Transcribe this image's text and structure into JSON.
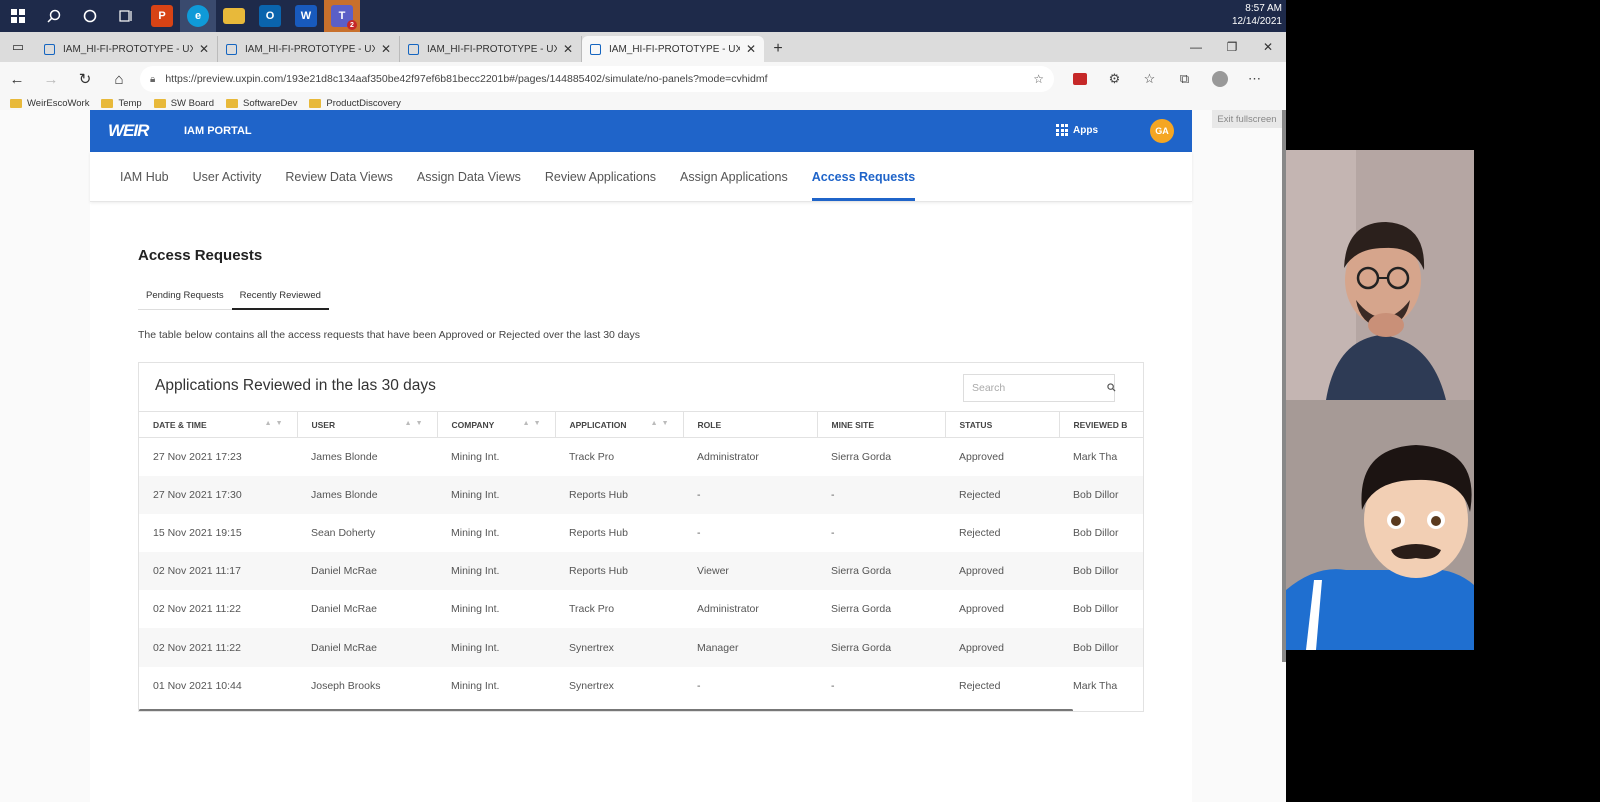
{
  "taskbar": {
    "time": "8:57 AM",
    "date": "12/14/2021",
    "apps": [
      {
        "icon": "windows-start-icon"
      },
      {
        "icon": "search-icon"
      },
      {
        "icon": "cortana-icon"
      },
      {
        "icon": "task-view-icon"
      },
      {
        "icon": "paint-app-icon",
        "color": "#d84315"
      },
      {
        "icon": "edge-browser-icon",
        "color": "#0f9ad8"
      },
      {
        "icon": "file-explorer-icon",
        "color": "#e8b93a"
      },
      {
        "icon": "outlook-icon",
        "color": "#0a64ad",
        "glyph": "O"
      },
      {
        "icon": "word-icon",
        "color": "#185abd",
        "glyph": "W"
      },
      {
        "icon": "teams-icon",
        "color": "#5b5fc7",
        "glyph": "T",
        "badge": "2"
      }
    ]
  },
  "browser": {
    "tabs": [
      {
        "title": "IAM_HI-FI-PROTOTYPE - UXPin F"
      },
      {
        "title": "IAM_HI-FI-PROTOTYPE - UXPin F"
      },
      {
        "title": "IAM_HI-FI-PROTOTYPE - UXPin F"
      },
      {
        "title": "IAM_HI-FI-PROTOTYPE - UXPin F"
      }
    ],
    "url": "https://preview.uxpin.com/193e21d8c134aaf350be42f97ef6b81becc2201b#/pages/144885402/simulate/no-panels?mode=cvhidmf",
    "bookmarks": [
      "WeirEscoWork",
      "Temp",
      "SW Board",
      "SoftwareDev",
      "ProductDiscovery"
    ],
    "exit_fullscreen": "Exit fullscreen"
  },
  "app": {
    "logo": "WEIR",
    "portal_title": "IAM PORTAL",
    "apps_label": "Apps",
    "avatar_initials": "GA",
    "nav": [
      "IAM Hub",
      "User Activity",
      "Review Data Views",
      "Assign Data Views",
      "Review Applications",
      "Assign Applications",
      "Access Requests"
    ],
    "active_nav_index": 6,
    "page_heading": "Access Requests",
    "subtabs": [
      "Pending Requests",
      "Recently Reviewed"
    ],
    "active_subtab_index": 1,
    "description": "The table below contains all the access requests that have been Approved or Rejected over the last 30 days",
    "card_title": "Applications Reviewed in the las 30 days",
    "search_placeholder": "Search",
    "columns": [
      "DATE & TIME",
      "USER",
      "COMPANY",
      "APPLICATION",
      "ROLE",
      "MINE SITE",
      "STATUS",
      "REVIEWED B"
    ],
    "rows": [
      [
        "27 Nov 2021 17:23",
        "James Blonde",
        "Mining Int.",
        "Track Pro",
        "Administrator",
        "Sierra Gorda",
        "Approved",
        "Mark Tha"
      ],
      [
        "27 Nov 2021 17:30",
        "James Blonde",
        "Mining Int.",
        "Reports Hub",
        "-",
        "-",
        "Rejected",
        "Bob Dillor"
      ],
      [
        "15 Nov 2021 19:15",
        "Sean Doherty",
        "Mining Int.",
        "Reports Hub",
        "-",
        "-",
        "Rejected",
        "Bob Dillor"
      ],
      [
        "02 Nov 2021 11:17",
        "Daniel McRae",
        "Mining Int.",
        "Reports Hub",
        "Viewer",
        "Sierra Gorda",
        "Approved",
        "Bob Dillor"
      ],
      [
        "02 Nov 2021 11:22",
        "Daniel McRae",
        "Mining Int.",
        "Track Pro",
        "Administrator",
        "Sierra Gorda",
        "Approved",
        "Bob Dillor"
      ],
      [
        "02 Nov 2021 11:22",
        "Daniel McRae",
        "Mining Int.",
        "Synertrex",
        "Manager",
        "Sierra Gorda",
        "Approved",
        "Bob Dillor"
      ],
      [
        "01 Nov 2021 10:44",
        "Joseph Brooks",
        "Mining Int.",
        "Synertrex",
        "-",
        "-",
        "Rejected",
        "Mark Tha"
      ]
    ]
  },
  "colors": {
    "brand_blue": "#1f64c9",
    "avatar": "#f5a623"
  }
}
